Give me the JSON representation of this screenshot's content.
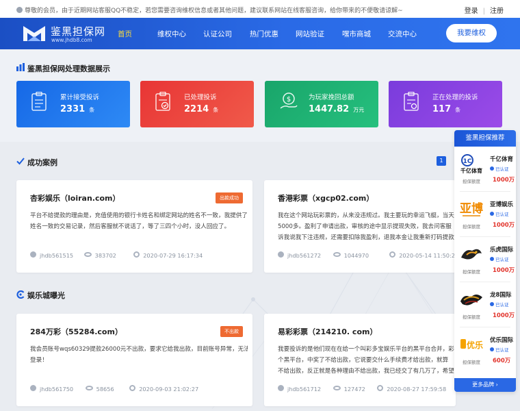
{
  "topbar": {
    "notice": "尊敬的会员，由于近期网站客服QQ不稳定，若您需要咨询维权信息或者其他问题，建议联系网站在线客服咨询，给你带来的不便敬请谅解~",
    "login": "登录",
    "separator": "|",
    "register": "注册"
  },
  "brand": {
    "name": "鉴黑担保网",
    "url": "www.jhdb8.com"
  },
  "nav": {
    "items": [
      "首页",
      "维权中心",
      "认证公司",
      "热门优惠",
      "网站验证",
      "嘿市商城",
      "交流中心"
    ],
    "active_index": 0,
    "cta": "我要维权"
  },
  "stats": {
    "title": "鉴黑担保网处理数据展示",
    "cards": [
      {
        "label": "累计接受投诉",
        "value": "2331",
        "unit": "条",
        "icon": "clipboard-list-icon"
      },
      {
        "label": "已处理投诉",
        "value": "2214",
        "unit": "条",
        "icon": "clipboard-check-icon"
      },
      {
        "label": "为玩家挽回总额",
        "value": "1447.82",
        "unit": "万元",
        "icon": "money-hand-icon"
      },
      {
        "label": "正在处理的投诉",
        "value": "117",
        "unit": "条",
        "icon": "clipboard-pending-icon"
      }
    ]
  },
  "success": {
    "title": "成功案例",
    "page": "1",
    "cards": [
      {
        "title": "杏彩娱乐（loiran.com）",
        "badge": "出款成功",
        "body": [
          "平台不给提款的理由是，充值使用的银行卡姓名和绑定网站的姓名不一致，我提供了",
          "姓名一致的交易记录，然后客服就不说话了，等了三四个小时，没人回应了。"
        ],
        "user": "jhdb561515",
        "views": "383702",
        "time": "2020-07-29 16:17:34"
      },
      {
        "title": "香港彩票（xgcp02.com）",
        "badge": "",
        "body": [
          "我在这个网站玩彩票的，从来没违规过。我主要玩的幸运飞艇，当天",
          "5000多。盈利了申请出款，审核的途中显示提现失败，我去问客服",
          "诉我说我下注违规，还需要扣除我盈利，退我本金让我重新打码提款"
        ],
        "user": "jhdb561272",
        "views": "1044970",
        "time": "2020-05-14 11:50:27"
      }
    ]
  },
  "exposure": {
    "title": "娱乐城曝光",
    "cards": [
      {
        "title": "284万彩（55284.com）",
        "badge": "不出款",
        "body": [
          "我会员账号wqs60329提款26000元不出款，要求它给我出款，目前账号异常，无法",
          "登录！"
        ],
        "user": "jhdb561750",
        "views": "58656",
        "time": "2020-09-03 21:02:27"
      },
      {
        "title": "易彩彩票（214210. com）",
        "badge": "",
        "body": [
          "我要投诉的是他们现在在给一个叫彩多宝娱乐平台的黑平台合并，彩多",
          "个黑平台，中奖了不给出款，它说要交什么手续费才给出款，就算",
          "不给出款，反正就是各种理由不给出款，我已经交了有几万了，希望鉴"
        ],
        "user": "jhdb561712",
        "views": "127472",
        "time": "2020-08-27 17:59:58"
      }
    ]
  },
  "sidebar": {
    "title": "鉴黑担保推荐",
    "more": "更多品牌",
    "brands": [
      {
        "name": "千亿体育",
        "status": "已认证",
        "deposit_label": "担保额度",
        "amount": "1000万",
        "logo_text": "千亿体育"
      },
      {
        "name": "亚博娱乐",
        "status": "已认证",
        "deposit_label": "担保额度",
        "amount": "1000万",
        "logo_text": "亚博"
      },
      {
        "name": "乐虎国际",
        "status": "已认证",
        "deposit_label": "担保额度",
        "amount": "1000万",
        "logo_text": ""
      },
      {
        "name": "龙8国际",
        "status": "已认证",
        "deposit_label": "担保额度",
        "amount": "1000万",
        "logo_text": ""
      },
      {
        "name": "优乐国际",
        "status": "已认证",
        "deposit_label": "担保额度",
        "amount": "600万",
        "logo_text": "优乐"
      }
    ]
  },
  "colors": {
    "primary": "#1d5fde",
    "stat_blue": "#1668e6",
    "stat_red": "#e83535",
    "stat_green": "#19a56a",
    "stat_purple": "#7a3cdc",
    "badge_orange": "#ee6a32",
    "amount_red": "#e2352d",
    "nav_active": "#ffde3a"
  }
}
